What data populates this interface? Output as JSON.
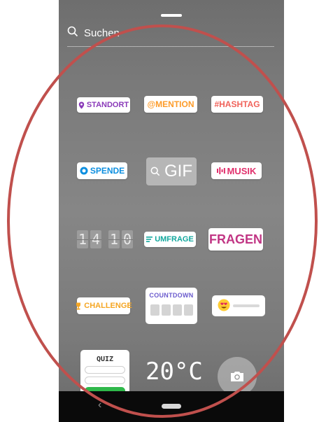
{
  "search": {
    "label": "Suchen",
    "icon": "search-icon"
  },
  "stickers": {
    "standort": {
      "label": "STANDORT",
      "icon": "location-pin-icon",
      "color": "#8a3ab9"
    },
    "mention": {
      "label": "@MENTION",
      "color": "#fd9c2a"
    },
    "hashtag": {
      "label": "#HASHTAG",
      "color": "#f0625a"
    },
    "spende": {
      "label": "SPENDE",
      "icon": "donation-icon",
      "color": "#0d8fe0"
    },
    "gif": {
      "label": "GIF",
      "icon": "search-icon"
    },
    "musik": {
      "label": "MUSIK",
      "icon": "music-bars-icon",
      "color": "#e1306c"
    },
    "time": {
      "digits": [
        "1",
        "4",
        "1",
        "0"
      ]
    },
    "umfrage": {
      "label": "UMFRAGE",
      "icon": "poll-lines-icon",
      "color": "#13a89e"
    },
    "fragen": {
      "label": "FRAGEN",
      "color": "#c13584"
    },
    "challenge": {
      "label": "CHALLENGE",
      "icon": "trophy-icon",
      "color": "#f5a623"
    },
    "countdown": {
      "label": "COUNTDOWN",
      "color": "#6a5acd"
    },
    "emoji_slider": {
      "icon": "heart-eyes-emoji-icon"
    },
    "quiz": {
      "label": "QUIZ"
    },
    "temperature": {
      "label": "20°C"
    }
  },
  "camera": {
    "icon": "camera-icon"
  },
  "navbar": {
    "back_icon": "back-chevron-icon",
    "home_icon": "home-pill-icon"
  },
  "colors": {
    "annotation": "#c0504d",
    "accent_gradient": [
      "#8a3ab9",
      "#e1306c",
      "#fd7e14"
    ]
  }
}
